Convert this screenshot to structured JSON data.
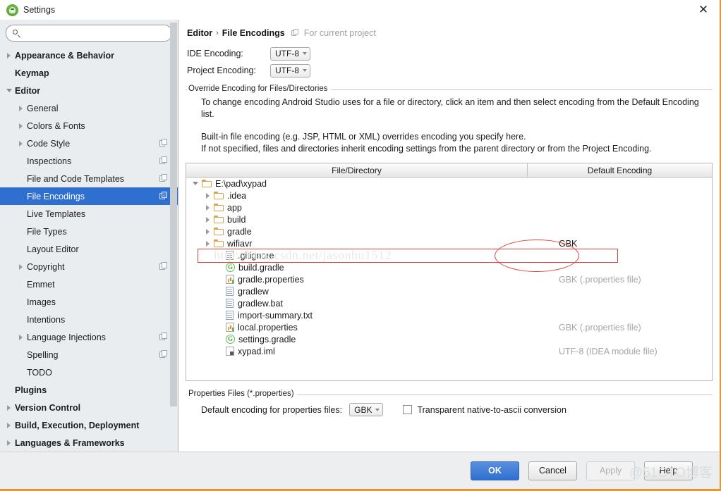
{
  "window": {
    "title": "Settings",
    "close_label": "✕",
    "app_icon": "android-studio-icon"
  },
  "sidebar": {
    "search_placeholder": "",
    "search_value": "",
    "items": [
      {
        "label": "Appearance & Behavior",
        "level": 0,
        "twisty": "right",
        "bold": true,
        "copy": false,
        "selected": false
      },
      {
        "label": "Keymap",
        "level": 0,
        "twisty": "none",
        "bold": true,
        "copy": false,
        "selected": false
      },
      {
        "label": "Editor",
        "level": 0,
        "twisty": "down",
        "bold": true,
        "copy": false,
        "selected": false
      },
      {
        "label": "General",
        "level": 1,
        "twisty": "right",
        "bold": false,
        "copy": false,
        "selected": false
      },
      {
        "label": "Colors & Fonts",
        "level": 1,
        "twisty": "right",
        "bold": false,
        "copy": false,
        "selected": false
      },
      {
        "label": "Code Style",
        "level": 1,
        "twisty": "right",
        "bold": false,
        "copy": true,
        "selected": false
      },
      {
        "label": "Inspections",
        "level": 1,
        "twisty": "none",
        "bold": false,
        "copy": true,
        "selected": false
      },
      {
        "label": "File and Code Templates",
        "level": 1,
        "twisty": "none",
        "bold": false,
        "copy": true,
        "selected": false
      },
      {
        "label": "File Encodings",
        "level": 1,
        "twisty": "none",
        "bold": false,
        "copy": true,
        "selected": true
      },
      {
        "label": "Live Templates",
        "level": 1,
        "twisty": "none",
        "bold": false,
        "copy": false,
        "selected": false
      },
      {
        "label": "File Types",
        "level": 1,
        "twisty": "none",
        "bold": false,
        "copy": false,
        "selected": false
      },
      {
        "label": "Layout Editor",
        "level": 1,
        "twisty": "none",
        "bold": false,
        "copy": false,
        "selected": false
      },
      {
        "label": "Copyright",
        "level": 1,
        "twisty": "right",
        "bold": false,
        "copy": true,
        "selected": false
      },
      {
        "label": "Emmet",
        "level": 1,
        "twisty": "none",
        "bold": false,
        "copy": false,
        "selected": false
      },
      {
        "label": "Images",
        "level": 1,
        "twisty": "none",
        "bold": false,
        "copy": false,
        "selected": false
      },
      {
        "label": "Intentions",
        "level": 1,
        "twisty": "none",
        "bold": false,
        "copy": false,
        "selected": false
      },
      {
        "label": "Language Injections",
        "level": 1,
        "twisty": "right",
        "bold": false,
        "copy": true,
        "selected": false
      },
      {
        "label": "Spelling",
        "level": 1,
        "twisty": "none",
        "bold": false,
        "copy": true,
        "selected": false
      },
      {
        "label": "TODO",
        "level": 1,
        "twisty": "none",
        "bold": false,
        "copy": false,
        "selected": false
      },
      {
        "label": "Plugins",
        "level": 0,
        "twisty": "none",
        "bold": true,
        "copy": false,
        "selected": false
      },
      {
        "label": "Version Control",
        "level": 0,
        "twisty": "right",
        "bold": true,
        "copy": false,
        "selected": false
      },
      {
        "label": "Build, Execution, Deployment",
        "level": 0,
        "twisty": "right",
        "bold": true,
        "copy": false,
        "selected": false
      },
      {
        "label": "Languages & Frameworks",
        "level": 0,
        "twisty": "right",
        "bold": true,
        "copy": false,
        "selected": false
      }
    ]
  },
  "main": {
    "breadcrumb": {
      "parent": "Editor",
      "separator": "›",
      "current": "File Encodings"
    },
    "scope_note": "For current project",
    "ide_encoding": {
      "label": "IDE Encoding:",
      "value": "UTF-8"
    },
    "project_encoding": {
      "label": "Project Encoding:",
      "value": "UTF-8"
    },
    "override_group": {
      "title": "Override Encoding for Files/Directories",
      "paragraph1": "To change encoding Android Studio uses for a file or directory, click an item and then select encoding from the Default Encoding list.",
      "paragraph2": "Built-in file encoding (e.g. JSP, HTML or XML) overrides encoding you specify here.",
      "paragraph3": "If not specified, files and directories inherit encoding settings from the parent directory or from the Project Encoding."
    },
    "table": {
      "columns": [
        "File/Directory",
        "Default Encoding"
      ],
      "rows": [
        {
          "name": "E:\\pad\\xypad",
          "encoding": "",
          "indent": 0,
          "twisty": "down",
          "icon": "folder-icon",
          "highlighted": false
        },
        {
          "name": ".idea",
          "encoding": "",
          "indent": 1,
          "twisty": "right",
          "icon": "folder-icon",
          "highlighted": false
        },
        {
          "name": "app",
          "encoding": "",
          "indent": 1,
          "twisty": "right",
          "icon": "folder-icon",
          "highlighted": false
        },
        {
          "name": "build",
          "encoding": "",
          "indent": 1,
          "twisty": "right",
          "icon": "folder-icon",
          "highlighted": false
        },
        {
          "name": "gradle",
          "encoding": "",
          "indent": 1,
          "twisty": "right",
          "icon": "folder-icon",
          "highlighted": false
        },
        {
          "name": "wifiavr",
          "encoding": "GBK",
          "indent": 1,
          "twisty": "right",
          "icon": "folder-icon",
          "highlighted": true
        },
        {
          "name": ".gitignore",
          "encoding": "",
          "indent": 2,
          "twisty": "none",
          "icon": "text-file-icon",
          "highlighted": false
        },
        {
          "name": "build.gradle",
          "encoding": "",
          "indent": 2,
          "twisty": "none",
          "icon": "gradle-file-icon",
          "highlighted": false
        },
        {
          "name": "gradle.properties",
          "encoding": "GBK (.properties file)",
          "indent": 2,
          "twisty": "none",
          "icon": "properties-file-icon",
          "highlighted": false
        },
        {
          "name": "gradlew",
          "encoding": "",
          "indent": 2,
          "twisty": "none",
          "icon": "text-file-icon",
          "highlighted": false
        },
        {
          "name": "gradlew.bat",
          "encoding": "",
          "indent": 2,
          "twisty": "none",
          "icon": "text-file-icon",
          "highlighted": false
        },
        {
          "name": "import-summary.txt",
          "encoding": "",
          "indent": 2,
          "twisty": "none",
          "icon": "text-file-icon",
          "highlighted": false
        },
        {
          "name": "local.properties",
          "encoding": "GBK (.properties file)",
          "indent": 2,
          "twisty": "none",
          "icon": "properties-file-icon",
          "highlighted": false
        },
        {
          "name": "settings.gradle",
          "encoding": "",
          "indent": 2,
          "twisty": "none",
          "icon": "gradle-file-icon",
          "highlighted": false
        },
        {
          "name": "xypad.iml",
          "encoding": "UTF-8 (IDEA module file)",
          "indent": 2,
          "twisty": "none",
          "icon": "iml-file-icon",
          "highlighted": false
        }
      ]
    },
    "properties_group": {
      "title": "Properties Files (*.properties)",
      "default_encoding_label": "Default encoding for properties files:",
      "default_encoding_value": "GBK",
      "transparent_label": "Transparent native-to-ascii conversion",
      "transparent_checked": false
    }
  },
  "footer": {
    "ok": "OK",
    "cancel": "Cancel",
    "apply": "Apply",
    "help": "Help"
  },
  "watermarks": {
    "url": "http://blog.csdn.net/jasonhu1512",
    "brand": "@51CTO博客"
  },
  "colors": {
    "accent": "#2f6fd0",
    "annotation": "#e8403a",
    "window_border": "#e8952a",
    "sidebar_bg": "#e9edf0"
  }
}
